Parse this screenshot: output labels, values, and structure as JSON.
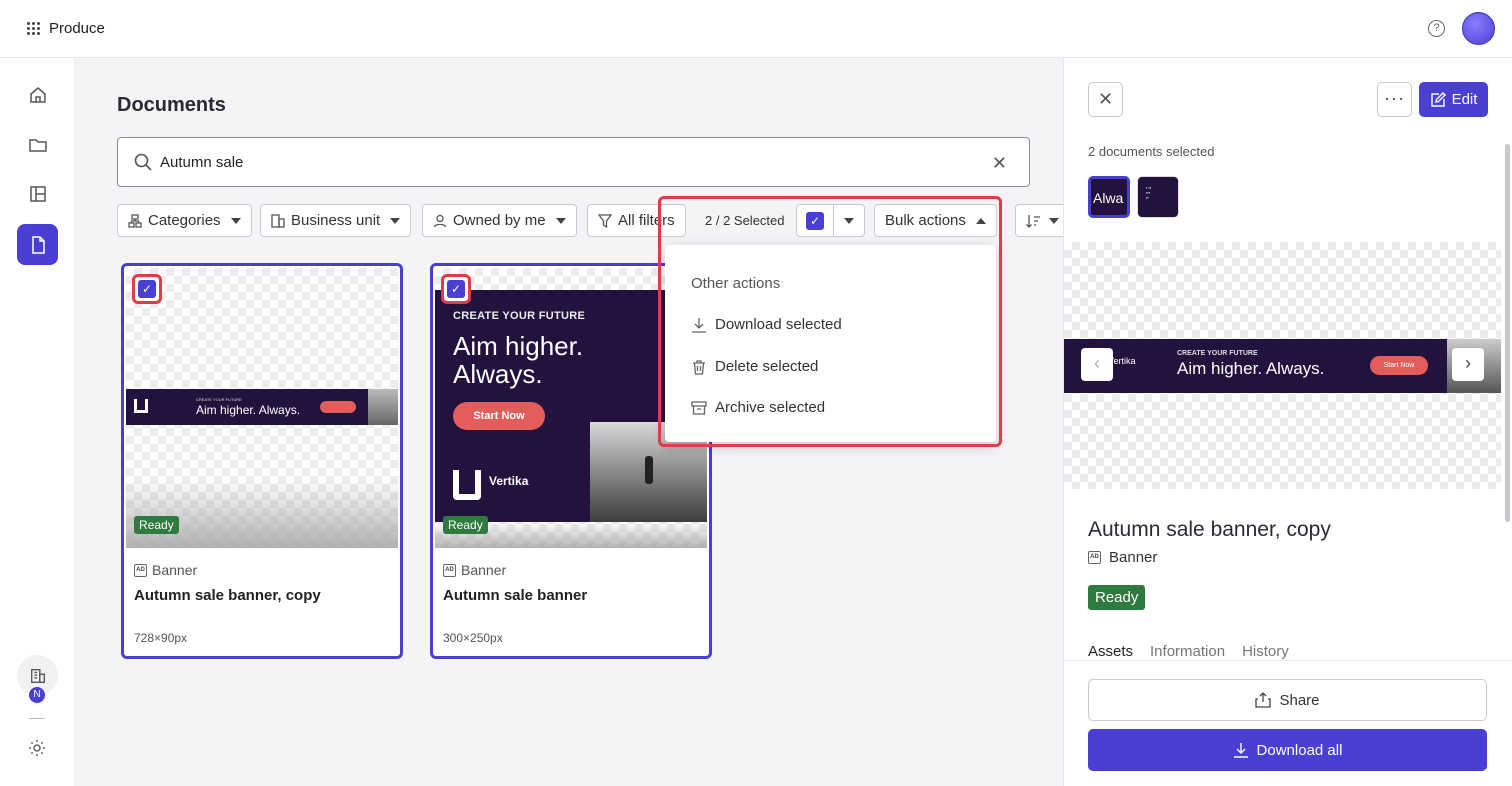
{
  "app": {
    "name": "Produce"
  },
  "colors": {
    "accent": "#4a3fd3",
    "ready": "#2f7a3e",
    "highlight": "#e03b46",
    "banner_bg": "#22123d",
    "cta": "#e35d5b"
  },
  "nav": {
    "items": [
      {
        "name": "home-icon",
        "active": false
      },
      {
        "name": "folder-icon",
        "active": false
      },
      {
        "name": "layout-icon",
        "active": false
      },
      {
        "name": "document-icon",
        "active": true
      }
    ],
    "org_badge": "N"
  },
  "main": {
    "title": "Documents",
    "search": {
      "value": "Autumn sale"
    },
    "filters": [
      "Categories",
      "Business unit",
      "Owned by me",
      "All filters"
    ],
    "selection": {
      "count_text": "2 / 2 Selected"
    },
    "bulk_actions_label": "Bulk actions"
  },
  "menu": {
    "header": "Other actions",
    "items": [
      "Download selected",
      "Delete selected",
      "Archive selected"
    ]
  },
  "cards": [
    {
      "status": "Ready",
      "type": "Banner",
      "name": "Autumn sale banner, copy",
      "dims": "728×90px",
      "thumb": {
        "small": "CREATE YOUR FUTURE",
        "big": "Aim higher. Always."
      }
    },
    {
      "status": "Ready",
      "type": "Banner",
      "name": "Autumn sale banner",
      "dims": "300×250px",
      "thumb": {
        "small": "CREATE YOUR FUTURE",
        "big": "Aim higher. Always.",
        "cta": "Start Now",
        "brand": "Vertika"
      }
    }
  ],
  "panel": {
    "edit_label": "Edit",
    "selected_text": "2 documents selected",
    "mini_texts": [
      "Alwa"
    ],
    "preview": {
      "brand": "Vertika",
      "small": "CREATE YOUR FUTURE",
      "big": "Aim higher. Always.",
      "cta": "Start Now"
    },
    "doc_title": "Autumn sale banner, copy",
    "doc_type": "Banner",
    "status": "Ready",
    "tabs": [
      "Assets",
      "Information",
      "History"
    ],
    "share_label": "Share",
    "download_label": "Download all"
  }
}
